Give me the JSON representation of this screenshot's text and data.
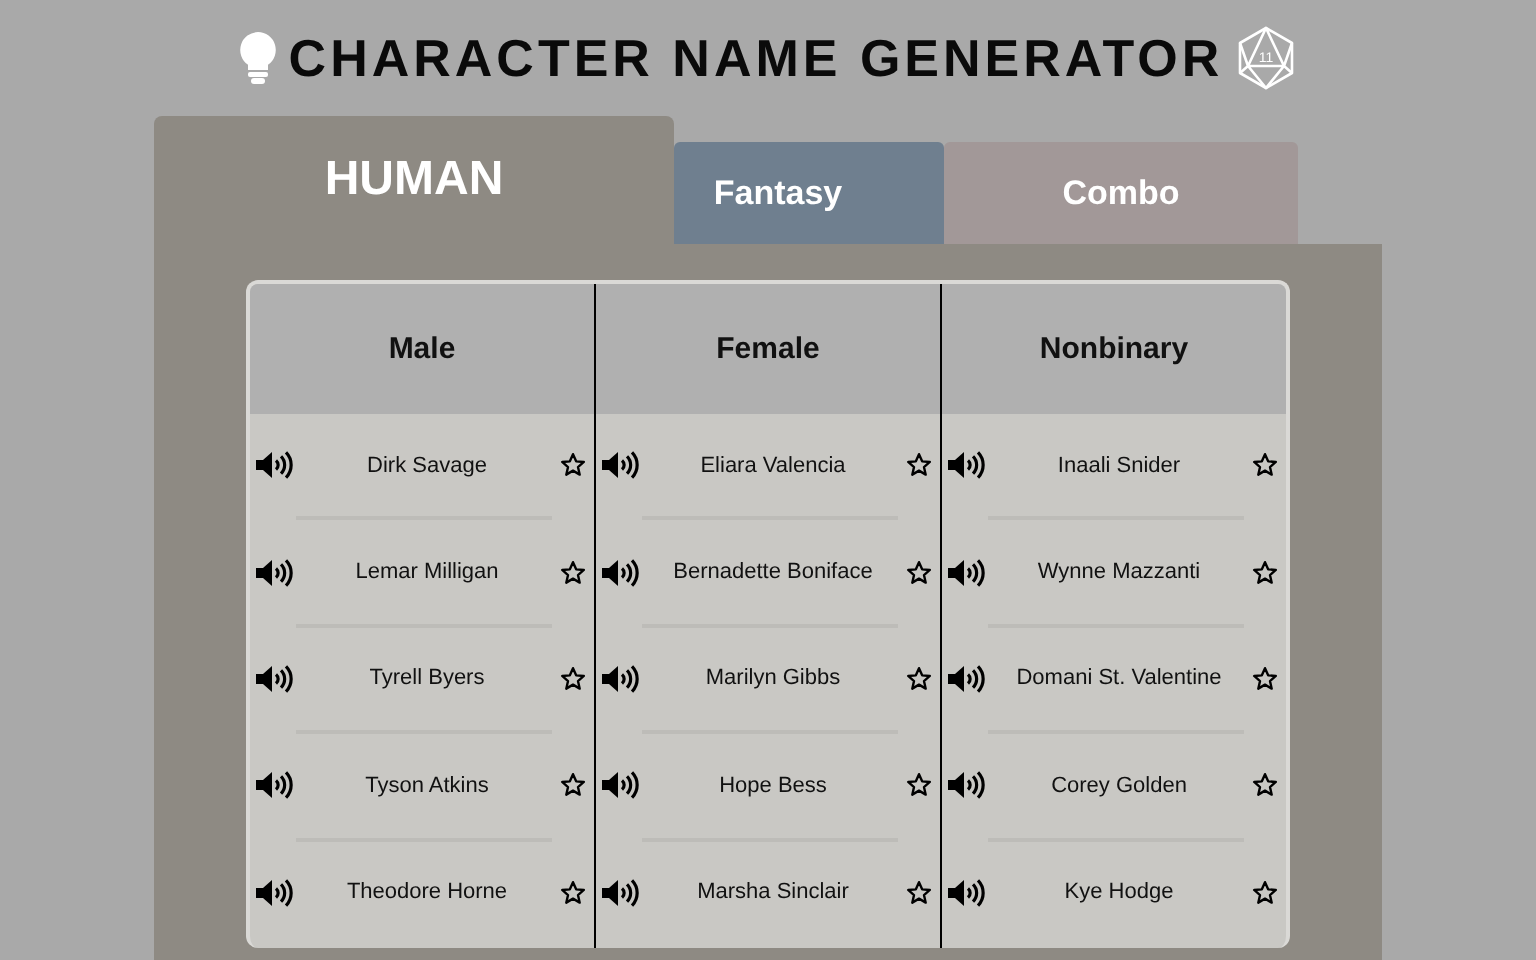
{
  "header": {
    "title": "CHARACTER NAME GENERATOR",
    "die_face": "11"
  },
  "tabs": [
    {
      "label": "HUMAN",
      "selected": true,
      "color": "#8e8a83"
    },
    {
      "label": "Fantasy",
      "selected": false,
      "color": "#6f7f8f"
    },
    {
      "label": "Combo",
      "selected": false,
      "color": "#a29898"
    }
  ],
  "table": {
    "columns": [
      {
        "heading": "Male",
        "names": [
          {
            "name": "Dirk Savage",
            "favorite": false
          },
          {
            "name": "Lemar Milligan",
            "favorite": false
          },
          {
            "name": "Tyrell Byers",
            "favorite": false
          },
          {
            "name": "Tyson Atkins",
            "favorite": false
          },
          {
            "name": "Theodore Horne",
            "favorite": false
          }
        ]
      },
      {
        "heading": "Female",
        "names": [
          {
            "name": "Eliara Valencia",
            "favorite": false
          },
          {
            "name": "Bernadette Boniface",
            "favorite": false
          },
          {
            "name": "Marilyn Gibbs",
            "favorite": false
          },
          {
            "name": "Hope Bess",
            "favorite": false
          },
          {
            "name": "Marsha Sinclair",
            "favorite": false
          }
        ]
      },
      {
        "heading": "Nonbinary",
        "names": [
          {
            "name": "Inaali Snider",
            "favorite": false
          },
          {
            "name": "Wynne Mazzanti",
            "favorite": false
          },
          {
            "name": "Domani St. Valentine",
            "favorite": false
          },
          {
            "name": "Corey Golden",
            "favorite": false
          },
          {
            "name": "Kye Hodge",
            "favorite": false
          }
        ]
      }
    ]
  }
}
